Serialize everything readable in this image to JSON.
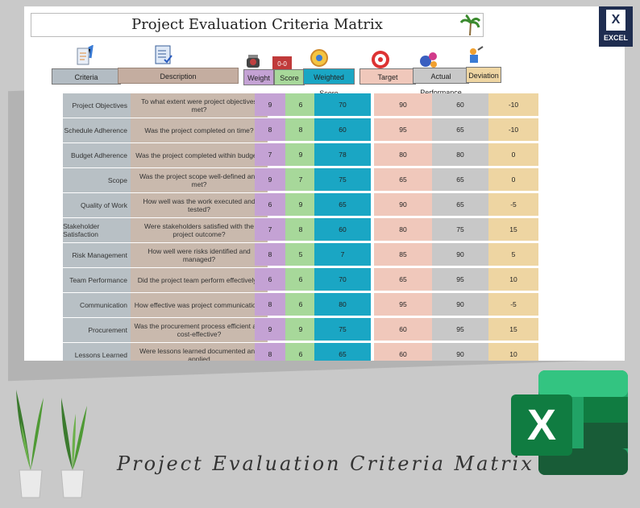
{
  "sheet": {
    "title": "Project Evaluation Criteria Matrix"
  },
  "headers": {
    "criteria": "Criteria",
    "description": "Description",
    "weight": "Weight",
    "score": "Score",
    "weighted_score": "Weighted Score",
    "target": "Target",
    "actual": "Actual Performance",
    "deviation": "Deviation"
  },
  "rows": [
    {
      "criteria": "Project Objectives",
      "description": "To what extent were project objectives met?",
      "weight": "9",
      "score": "6",
      "weighted": "70",
      "target": "90",
      "actual": "60",
      "deviation": "-10"
    },
    {
      "criteria": "Schedule Adherence",
      "description": "Was the project completed on time?",
      "weight": "8",
      "score": "8",
      "weighted": "60",
      "target": "95",
      "actual": "65",
      "deviation": "-10"
    },
    {
      "criteria": "Budget Adherence",
      "description": "Was the project completed within budget?",
      "weight": "7",
      "score": "9",
      "weighted": "78",
      "target": "80",
      "actual": "80",
      "deviation": "0"
    },
    {
      "criteria": "Scope",
      "description": "Was the project scope well-defined and met?",
      "weight": "9",
      "score": "7",
      "weighted": "75",
      "target": "65",
      "actual": "65",
      "deviation": "0"
    },
    {
      "criteria": "Quality of Work",
      "description": "How well was the work executed and tested?",
      "weight": "6",
      "score": "9",
      "weighted": "65",
      "target": "90",
      "actual": "65",
      "deviation": "-5"
    },
    {
      "criteria": "Stakeholder Satisfaction",
      "description": "Were stakeholders satisfied with the project outcome?",
      "weight": "7",
      "score": "8",
      "weighted": "60",
      "target": "80",
      "actual": "75",
      "deviation": "15"
    },
    {
      "criteria": "Risk Management",
      "description": "How well were risks identified and managed?",
      "weight": "8",
      "score": "5",
      "weighted": "7",
      "target": "85",
      "actual": "90",
      "deviation": "5"
    },
    {
      "criteria": "Team Performance",
      "description": "Did the project team perform effectively?",
      "weight": "6",
      "score": "6",
      "weighted": "70",
      "target": "65",
      "actual": "95",
      "deviation": "10"
    },
    {
      "criteria": "Communication",
      "description": "How effective was project communication?",
      "weight": "8",
      "score": "6",
      "weighted": "80",
      "target": "95",
      "actual": "90",
      "deviation": "-5"
    },
    {
      "criteria": "Procurement",
      "description": "Was the procurement process efficient and cost-effective?",
      "weight": "9",
      "score": "9",
      "weighted": "75",
      "target": "60",
      "actual": "95",
      "deviation": "15"
    },
    {
      "criteria": "Lessons Learned",
      "description": "Were lessons learned documented and applied",
      "weight": "8",
      "score": "6",
      "weighted": "65",
      "target": "60",
      "actual": "90",
      "deviation": "10"
    }
  ],
  "badge": {
    "letter": "X",
    "label": "EXCEL"
  },
  "footer": {
    "title": "Project Evaluation Criteria Matrix",
    "logo_letter": "X"
  },
  "colors": {
    "weight": "#c4a2d4",
    "score": "#a7d89a",
    "weighted": "#1aa6c4",
    "target": "#f0c8bb",
    "actual": "#c8c8c8",
    "deviation": "#eed5a2",
    "excel_green": "#1d7a45"
  },
  "icons": [
    "palm-tree-icon",
    "clipboard-pencil-icon",
    "checklist-icon",
    "scale-icon",
    "scoreboard-icon",
    "gear-chart-icon",
    "target-icon",
    "gears-icon",
    "wrench-figure-icon",
    "excel-icon",
    "plant-icon"
  ]
}
